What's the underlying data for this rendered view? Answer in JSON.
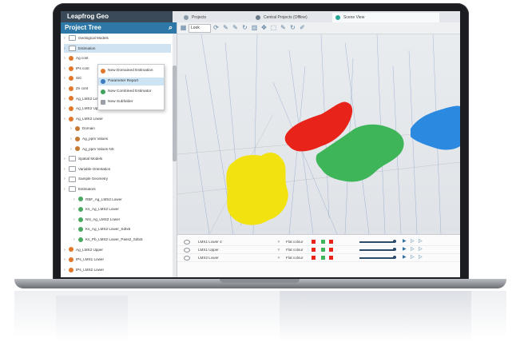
{
  "app": {
    "name": "Leapfrog Geo"
  },
  "tabs": [
    {
      "label": "Projects"
    },
    {
      "label": "Central Projects (Offline)"
    },
    {
      "label": "Scene View"
    }
  ],
  "panel": {
    "title": "Project Tree",
    "scroll_icon": "⌕"
  },
  "tree": [
    {
      "label": "Geological Models",
      "kind": "folder"
    },
    {
      "label": "Estimation",
      "kind": "folder",
      "selected": true
    },
    {
      "label": "Ag cont",
      "kind": "domain"
    },
    {
      "label": "IPs cont",
      "kind": "domain"
    },
    {
      "label": "SiC",
      "kind": "domain"
    },
    {
      "label": "Zn cont",
      "kind": "domain"
    },
    {
      "label": "Ag_LMS2 Lower",
      "kind": "domain"
    },
    {
      "label": "Ag_LMS2 Upper",
      "kind": "domain"
    },
    {
      "label": "Ag_LMS2 Lower",
      "kind": "domain"
    },
    {
      "label": "Domain",
      "kind": "sub"
    },
    {
      "label": "Ag_ppm Values",
      "kind": "sub"
    },
    {
      "label": "Ag_ppm Values NS",
      "kind": "sub"
    },
    {
      "label": "Spatial Models",
      "kind": "folder"
    },
    {
      "label": "Variable Orientation",
      "kind": "folder"
    },
    {
      "label": "Sample Geometry",
      "kind": "folder"
    },
    {
      "label": "Estimators",
      "kind": "folder"
    },
    {
      "label": "RBF_Ag_LMS2 Lower",
      "kind": "est"
    },
    {
      "label": "Ks_Ag_LMS2 Lower",
      "kind": "est"
    },
    {
      "label": "NN_Ag_LMS2 Lower",
      "kind": "est"
    },
    {
      "label": "Ks_Ag_LMS2 Lower_Sdtx5",
      "kind": "est"
    },
    {
      "label": "Ks_Pb_LMS2 Lower_Pass2_Sdtx5",
      "kind": "est"
    },
    {
      "label": "Ag_LMS2 Upper",
      "kind": "domain"
    },
    {
      "label": "IPs_LMS1 Lower",
      "kind": "domain"
    },
    {
      "label": "IPs_LMS2 Lower",
      "kind": "domain"
    }
  ],
  "context_menu": [
    {
      "label": "New Domained Estimation"
    },
    {
      "label": "Parameter Report",
      "highlight": true
    },
    {
      "label": "New Combined Estimator"
    },
    {
      "label": "New Subfolder"
    }
  ],
  "toolbar": {
    "look": "Look"
  },
  "bottom_rows": [
    {
      "name": "LMS1 Lower 4",
      "style": "Flat colour"
    },
    {
      "name": "LMS1 Upper",
      "style": "Flat colour"
    },
    {
      "name": "LMS2 Lower",
      "style": "Flat colour"
    }
  ],
  "colors": {
    "yellow": "#f2e20f",
    "red": "#e8231a",
    "green": "#3fb55a",
    "blue": "#2b8ae0"
  }
}
